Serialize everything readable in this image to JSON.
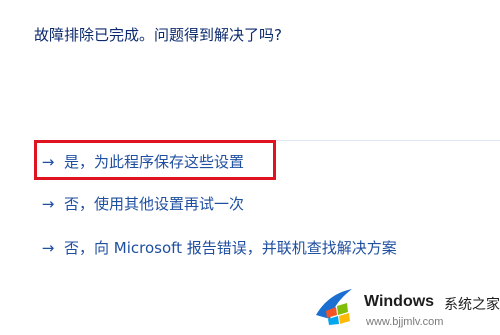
{
  "heading": "故障排除已完成。问题得到解决了吗?",
  "options": [
    {
      "arrow": "→",
      "label": "是，为此程序保存这些设置",
      "highlighted": true
    },
    {
      "arrow": "→",
      "label": "否，使用其他设置再试一次",
      "highlighted": false
    },
    {
      "arrow": "→",
      "label": "否，向 Microsoft 报告错误，并联机查找解决方案",
      "highlighted": false
    }
  ],
  "colors": {
    "heading": "#0c2a6e",
    "link": "#1f4fa0",
    "highlight_border": "#e0141e"
  },
  "watermark": {
    "icon": "windows-logo-icon",
    "title": "Windows",
    "chinese": "系统之家",
    "url": "www.bjjmlv.com"
  }
}
